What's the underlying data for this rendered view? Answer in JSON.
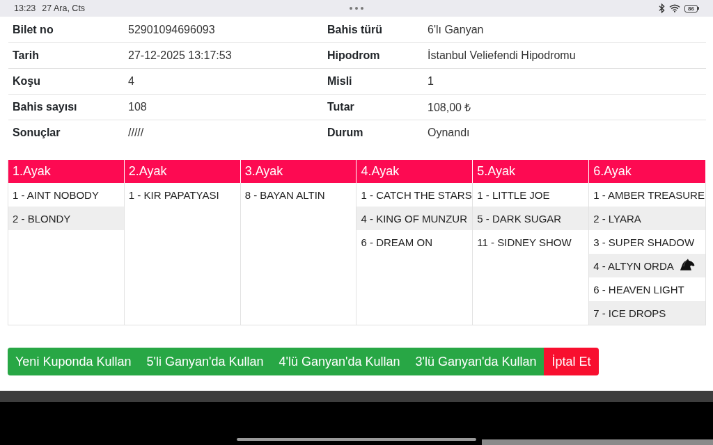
{
  "status_bar": {
    "time": "13:23",
    "date": "27 Ara, Cts",
    "battery": "86"
  },
  "ticket_details": {
    "rows": [
      {
        "left": {
          "label": "Bilet no",
          "value": "52901094696093"
        },
        "right": {
          "label": "Bahis türü",
          "value": "6'lı Ganyan"
        }
      },
      {
        "left": {
          "label": "Tarih",
          "value": "27-12-2025 13:17:53"
        },
        "right": {
          "label": "Hipodrom",
          "value": "İstanbul Veliefendi Hipodromu"
        }
      },
      {
        "left": {
          "label": "Koşu",
          "value": "4"
        },
        "right": {
          "label": "Misli",
          "value": "1"
        }
      },
      {
        "left": {
          "label": "Bahis sayısı",
          "value": "108"
        },
        "right": {
          "label": "Tutar",
          "value": "108,00 ₺"
        }
      },
      {
        "left": {
          "label": "Sonuçlar",
          "value": "/////"
        },
        "right": {
          "label": "Durum",
          "value": "Oynandı"
        }
      }
    ]
  },
  "legs": [
    {
      "title": "1.Ayak",
      "horses": [
        {
          "name": "1 - AINT NOBODY",
          "marked": false
        },
        {
          "name": "2 - BLONDY",
          "marked": false
        }
      ]
    },
    {
      "title": "2.Ayak",
      "horses": [
        {
          "name": "1 - KIR PAPATYASI",
          "marked": false
        }
      ]
    },
    {
      "title": "3.Ayak",
      "horses": [
        {
          "name": "8 - BAYAN ALTIN",
          "marked": false
        }
      ]
    },
    {
      "title": "4.Ayak",
      "horses": [
        {
          "name": "1 - CATCH THE STARS",
          "marked": false
        },
        {
          "name": "4 - KING OF MUNZUR",
          "marked": false
        },
        {
          "name": "6 - DREAM ON",
          "marked": false
        }
      ]
    },
    {
      "title": "5.Ayak",
      "horses": [
        {
          "name": "1 - LITTLE JOE",
          "marked": false
        },
        {
          "name": "5 - DARK SUGAR",
          "marked": false
        },
        {
          "name": "11 - SIDNEY SHOW",
          "marked": false
        }
      ]
    },
    {
      "title": "6.Ayak",
      "horses": [
        {
          "name": "1 - AMBER TREASURE",
          "marked": false
        },
        {
          "name": "2 - LYARA",
          "marked": false
        },
        {
          "name": "3 - SUPER SHADOW",
          "marked": false
        },
        {
          "name": "4 - ALTYN ORDA",
          "marked": true
        },
        {
          "name": "6 - HEAVEN LIGHT",
          "marked": false
        },
        {
          "name": "7 - ICE DROPS",
          "marked": false
        }
      ]
    }
  ],
  "actions": [
    {
      "label": "Yeni Kuponda Kullan",
      "kind": "success"
    },
    {
      "label": "5'li Ganyan'da Kullan",
      "kind": "success"
    },
    {
      "label": "4'lü Ganyan'da Kullan",
      "kind": "success"
    },
    {
      "label": "3'lü Ganyan'da Kullan",
      "kind": "success"
    },
    {
      "label": "İptal Et",
      "kind": "danger"
    }
  ]
}
